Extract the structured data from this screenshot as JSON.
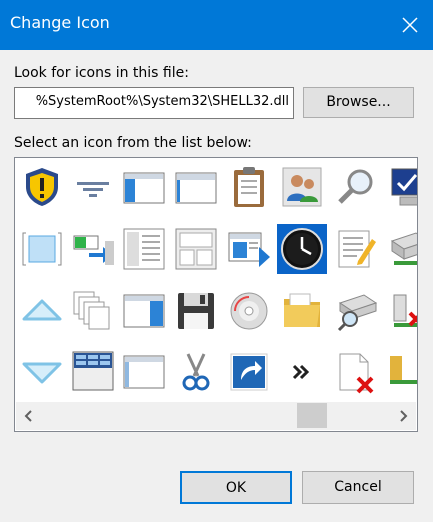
{
  "dialog": {
    "title": "Change Icon",
    "accent": "#0078d7"
  },
  "file": {
    "label": "Look for icons in this file:",
    "path_value": "%SystemRoot%\\System32\\SHELL32.dll",
    "browse_label": "Browse..."
  },
  "list": {
    "label": "Select an icon from the list below:",
    "selected_icon": "clock-icon",
    "columns": [
      [
        "shield-warning-icon",
        "box-icon",
        "up-arrow-icon",
        "down-arrow-icon"
      ],
      [
        "funnel-icon",
        "toggle-to-window-icon",
        "stacked-pages-icon",
        "taskbar-window-icon"
      ],
      [
        "window-left-pane-icon",
        "document-list-icon",
        "window-blue-pane-icon",
        "window-icon"
      ],
      [
        "window-tab-icon",
        "window-frame-icon",
        "floppy-disk-icon",
        "scissors-icon"
      ],
      [
        "clipboard-icon",
        "window-arrow-icon",
        "cd-rom-icon",
        "shortcut-arrow-icon"
      ],
      [
        "users-icon",
        "clock-icon",
        "folder-icon",
        "double-chevron-icon"
      ],
      [
        "magnifier-icon",
        "notepad-icon",
        "search-drive-icon",
        "document-x-icon"
      ],
      [
        "computer-check-icon",
        "network-drive-icon",
        "network-drive-x-icon",
        "folder-network-icon"
      ]
    ]
  },
  "scroll": {
    "left_icon": "chevron-left-icon",
    "right_icon": "chevron-right-icon"
  },
  "buttons": {
    "ok_label": "OK",
    "cancel_label": "Cancel"
  }
}
